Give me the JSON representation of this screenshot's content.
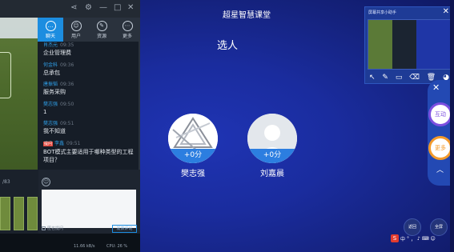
{
  "left_app": {
    "titlebar_icons": [
      "share-icon",
      "gear-icon",
      "minimize-icon",
      "maximize-icon",
      "close-icon"
    ],
    "tabs": [
      {
        "label": "聊天",
        "icon": "chat-icon"
      },
      {
        "label": "用户",
        "icon": "user-icon"
      },
      {
        "label": "资源",
        "icon": "edit-icon"
      },
      {
        "label": "更多",
        "icon": "more-icon"
      }
    ],
    "messages": [
      {
        "user": "肖杰元",
        "time": "09:35",
        "text": "企业管理费"
      },
      {
        "user": "何金科",
        "time": "09:36",
        "text": "总承包"
      },
      {
        "user": "唐振韬",
        "time": "09:36",
        "text": "服务采购"
      },
      {
        "user": "樊志强",
        "time": "09:50",
        "text": "1"
      },
      {
        "user": "樊志强",
        "time": "09:51",
        "text": "我不知道"
      }
    ],
    "question": {
      "badge": "提问",
      "user": "李鑫",
      "time": "09:51",
      "text": "BOT模式主要适用于哪种类型的工程项目？"
    },
    "pager": "/83",
    "compose_check": "匿名提问",
    "send_button": "发表评论",
    "speed": "11.66 kB/s",
    "cpu": "CPU: 26 %"
  },
  "classroom": {
    "title": "超星智慧课堂",
    "heading": "选人",
    "students": [
      {
        "name": "樊志强",
        "score": "+0分",
        "avatar": "graphic-avatar"
      },
      {
        "name": "刘嘉晨",
        "score": "+0分",
        "avatar": "default-avatar"
      }
    ],
    "assistant": {
      "title": "屏幕共享小助手",
      "tools": [
        "pointer-icon",
        "pen-icon",
        "rectangle-icon",
        "eraser-icon",
        "trash-icon",
        "palette-icon"
      ]
    },
    "side": {
      "interact": "互动",
      "more": "更多"
    },
    "back_button": "返回",
    "fullscreen_button": "全屏",
    "ime_items": [
      "中",
      "°",
      "，",
      "♪",
      "⌨",
      "☺"
    ]
  },
  "colors": {
    "accent": "#1c8de0",
    "classroom_bg": "#1a2c9e",
    "interact_ring": "#7c4fe0",
    "more_ring": "#f39a2a"
  }
}
